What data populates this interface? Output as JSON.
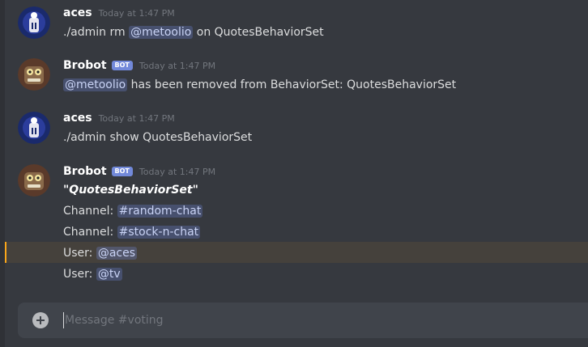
{
  "messages": [
    {
      "author": "aces",
      "bot": false,
      "timestamp": "Today at 1:47 PM",
      "lines": [
        {
          "pre": "./admin rm ",
          "mention": "@metoolio",
          "post": " on QuotesBehaviorSet"
        }
      ]
    },
    {
      "author": "Brobot",
      "bot": true,
      "bot_label": "BOT",
      "timestamp": "Today at 1:47 PM",
      "lines": [
        {
          "pre": "",
          "mention": "@metoolio",
          "post": " has been removed from BehaviorSet: QuotesBehaviorSet"
        }
      ]
    },
    {
      "author": "aces",
      "bot": false,
      "timestamp": "Today at 1:47 PM",
      "lines": [
        {
          "text": "./admin show QuotesBehaviorSet"
        }
      ]
    },
    {
      "author": "Brobot",
      "bot": true,
      "bot_label": "BOT",
      "timestamp": "Today at 1:47 PM",
      "lines": [
        {
          "title": "\"QuotesBehaviorSet\""
        },
        {
          "label": "Channel: ",
          "mention": "#random-chat"
        },
        {
          "label": "Channel: ",
          "mention": "#stock-n-chat"
        },
        {
          "label": "User: ",
          "mention": "@aces"
        },
        {
          "label": "User: ",
          "mention": "@tv"
        }
      ]
    }
  ],
  "composer": {
    "placeholder": "Message #voting",
    "value": ""
  },
  "icons": {
    "composer_add": "plus-circle-icon"
  },
  "colors": {
    "background": "#36393f",
    "mention_bg": "#7289da",
    "bot_tag": "#7289da",
    "highlight_bar": "#faa61a",
    "composer_bg": "#40444b"
  }
}
